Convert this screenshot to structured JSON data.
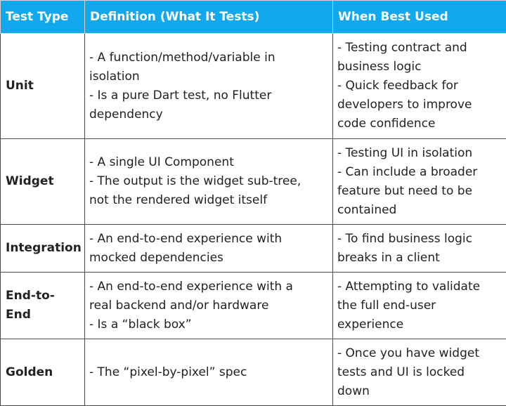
{
  "headers": [
    "Test Type",
    "Definition (What It Tests)",
    "When Best Used"
  ],
  "rows": [
    {
      "type": "Unit",
      "definition": [
        "- A function/method/variable in",
        "isolation",
        "- Is a pure Dart test, no Flutter",
        "dependency"
      ],
      "when": [
        "- Testing contract and",
        "business logic",
        "- Quick feedback for",
        "developers to improve",
        "code confidence"
      ]
    },
    {
      "type": "Widget",
      "definition": [
        "- A single UI Component",
        "- The output is the widget sub-tree,",
        "not the rendered widget itself"
      ],
      "when": [
        "- Testing UI in isolation",
        "- Can include a broader",
        "feature but need to be",
        "contained"
      ]
    },
    {
      "type": "Integration",
      "definition": [
        "- An end-to-end experience with",
        "mocked dependencies"
      ],
      "when": [
        "- To find business logic",
        "breaks in a client"
      ]
    },
    {
      "type": [
        "End-to-",
        "End"
      ],
      "definition": [
        "- An end-to-end experience with a",
        "real backend and/or hardware",
        "- Is a “black box”"
      ],
      "when": [
        "- Attempting to validate",
        "the full end-user",
        "experience"
      ]
    },
    {
      "type": "Golden",
      "definition": [
        "- The “pixel-by-pixel” spec"
      ],
      "when": [
        "- Once you have widget",
        "tests and UI is locked",
        "down"
      ]
    }
  ],
  "colors": {
    "header_bg": "#12a8ee",
    "header_text": "#ffffff",
    "body_text": "#222222",
    "grid": "#4a4a4a"
  }
}
